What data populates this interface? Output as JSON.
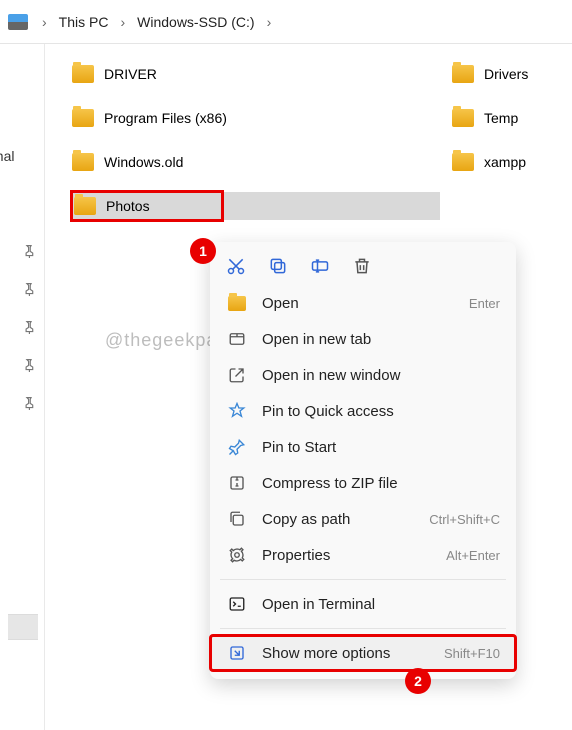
{
  "breadcrumb": {
    "pc": "This PC",
    "drive": "Windows-SSD (C:)"
  },
  "sidebar": {
    "label": "onal"
  },
  "folders": {
    "left": [
      "DRIVER",
      "Program Files (x86)",
      "Windows.old",
      "Photos"
    ],
    "right": [
      "Drivers",
      "Temp",
      "xampp"
    ]
  },
  "badge1": "1",
  "badge2": "2",
  "watermark": "@thegeekpage.com",
  "menu": {
    "open": "Open",
    "open_sc": "Enter",
    "tab": "Open in new tab",
    "window": "Open in new window",
    "quick": "Pin to Quick access",
    "start": "Pin to Start",
    "zip": "Compress to ZIP file",
    "copy": "Copy as path",
    "copy_sc": "Ctrl+Shift+C",
    "props": "Properties",
    "props_sc": "Alt+Enter",
    "term": "Open in Terminal",
    "more": "Show more options",
    "more_sc": "Shift+F10"
  }
}
